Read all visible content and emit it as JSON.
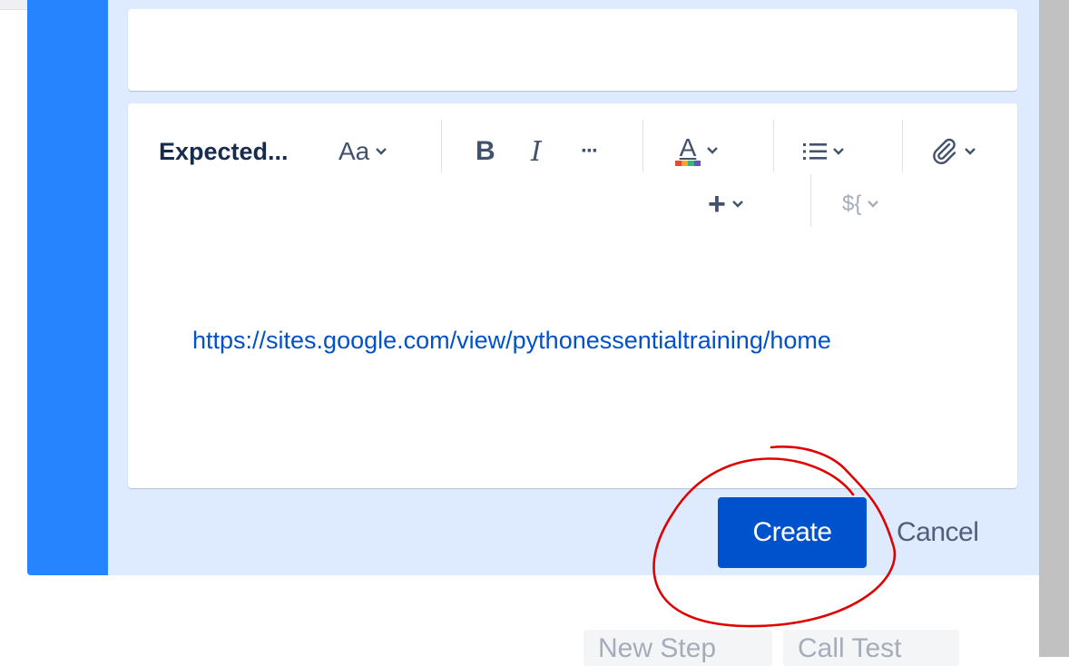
{
  "editor": {
    "field_label": "Expected...",
    "toolbar": {
      "text_style": "Aa",
      "bold": "B",
      "italic": "I",
      "more": "···",
      "text_color": "A",
      "list": "☰",
      "attachment": "📎",
      "insert": "+",
      "variable": "${"
    },
    "content_link": "https://sites.google.com/view/pythonessentialtraining/home"
  },
  "actions": {
    "create_label": "Create",
    "cancel_label": "Cancel"
  },
  "bottom_buttons": {
    "new_step_label": "New Step",
    "call_test_label": "Call Test"
  },
  "colors": {
    "accent_bar": "#2684ff",
    "panel_bg": "#deebff",
    "primary_button": "#0052cc",
    "link": "#0052cc",
    "annotation_circle": "#e00000"
  }
}
